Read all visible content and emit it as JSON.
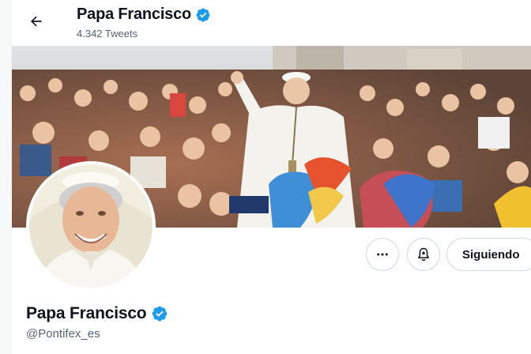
{
  "header": {
    "back_icon": "arrow-left-icon",
    "name": "Papa Francisco",
    "tweet_count": "4.342 Tweets",
    "verified_icon": "verified-badge-icon"
  },
  "banner": {
    "description_icon": "crowd-photo"
  },
  "avatar": {
    "icon": "profile-photo"
  },
  "actions": {
    "more_icon": "more-dots-icon",
    "notify_icon": "bell-plus-icon",
    "following_label": "Siguiendo"
  },
  "profile": {
    "name": "Papa Francisco",
    "handle": "@Pontifex_es"
  },
  "colors": {
    "verified": "#1d9bf0",
    "secondary_text": "#536471",
    "border": "#cfd9de"
  }
}
